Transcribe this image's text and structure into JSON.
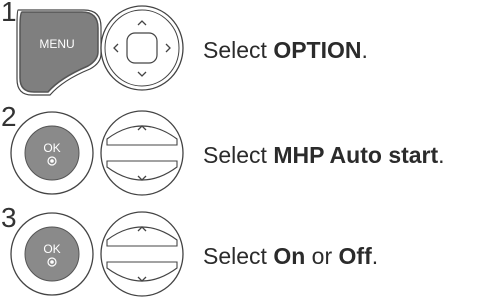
{
  "steps": [
    {
      "number": "1",
      "buttons": [
        "menu-key-icon",
        "navigation-pad-icon"
      ],
      "menu_label": "MENU",
      "text_prefix": "Select ",
      "text_bold": "OPTION",
      "text_suffix": "."
    },
    {
      "number": "2",
      "buttons": [
        "ok-key-icon",
        "up-down-key-icon"
      ],
      "ok_label": "OK",
      "text_prefix": "Select ",
      "text_bold": "MHP Auto start",
      "text_suffix": "."
    },
    {
      "number": "3",
      "buttons": [
        "ok-key-icon",
        "up-down-key-icon"
      ],
      "ok_label": "OK",
      "text_prefix": "Select ",
      "text_bold": "On",
      "text_middle": " or ",
      "text_bold2": "Off",
      "text_suffix": "."
    }
  ],
  "colors": {
    "key_fill": "#808080",
    "key_outline": "#555555",
    "pad_fill": "#ffffff",
    "text": "#2b2b2b"
  }
}
